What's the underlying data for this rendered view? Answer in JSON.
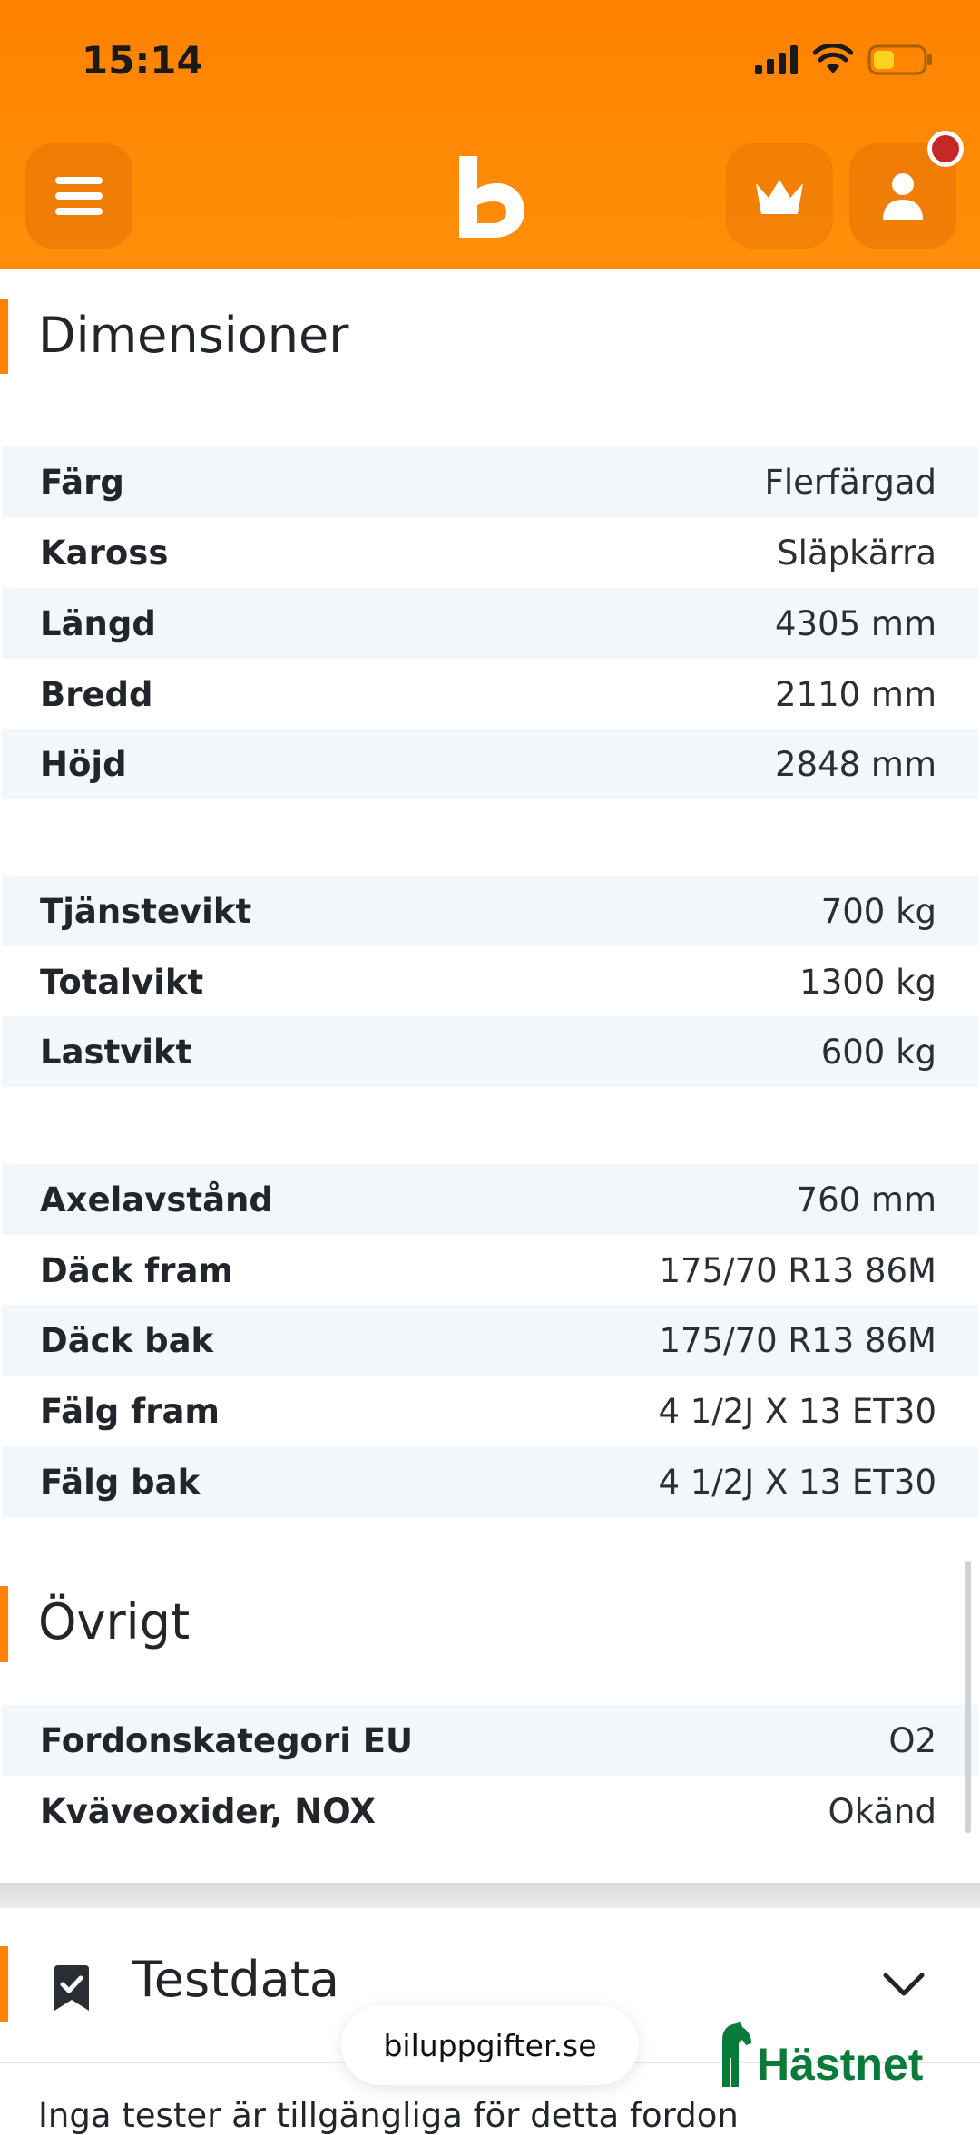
{
  "status_bar": {
    "time": "15:14"
  },
  "header": {
    "menu_icon": "hamburger-icon",
    "logo_icon": "b-logo-icon",
    "premium_icon": "crown-icon",
    "account_icon": "user-icon",
    "accent_color": "#ff8200",
    "notification_color": "#c62828"
  },
  "dimensioner": {
    "title": "Dimensioner",
    "group1": [
      {
        "label": "Färg",
        "value": "Flerfärgad"
      },
      {
        "label": "Kaross",
        "value": "Släpkärra"
      },
      {
        "label": "Längd",
        "value": "4305 mm"
      },
      {
        "label": "Bredd",
        "value": "2110 mm"
      },
      {
        "label": "Höjd",
        "value": "2848 mm"
      }
    ],
    "group2": [
      {
        "label": "Tjänstevikt",
        "value": "700 kg"
      },
      {
        "label": "Totalvikt",
        "value": "1300 kg"
      },
      {
        "label": "Lastvikt",
        "value": "600 kg"
      }
    ],
    "group3": [
      {
        "label": "Axelavstånd",
        "value": "760 mm"
      },
      {
        "label": "Däck fram",
        "value": "175/70 R13 86M"
      },
      {
        "label": "Däck bak",
        "value": "175/70 R13 86M"
      },
      {
        "label": "Fälg fram",
        "value": "4 1/2J X 13 ET30"
      },
      {
        "label": "Fälg bak",
        "value": "4 1/2J X 13 ET30"
      }
    ]
  },
  "ovrigt": {
    "title": "Övrigt",
    "rows": [
      {
        "label": "Fordonskategori EU",
        "value": "O2"
      },
      {
        "label": "Kväveoxider, NOX",
        "value": "Okänd"
      }
    ]
  },
  "testdata": {
    "title": "Testdata",
    "icon": "bookmark-check-icon",
    "toggle_icon": "chevron-down-icon",
    "text": "Inga tester är tillgängliga för detta fordon"
  },
  "browser": {
    "url": "biluppgifter.se"
  },
  "brand": {
    "name": "Hästnet",
    "color": "#0a7a3a"
  }
}
